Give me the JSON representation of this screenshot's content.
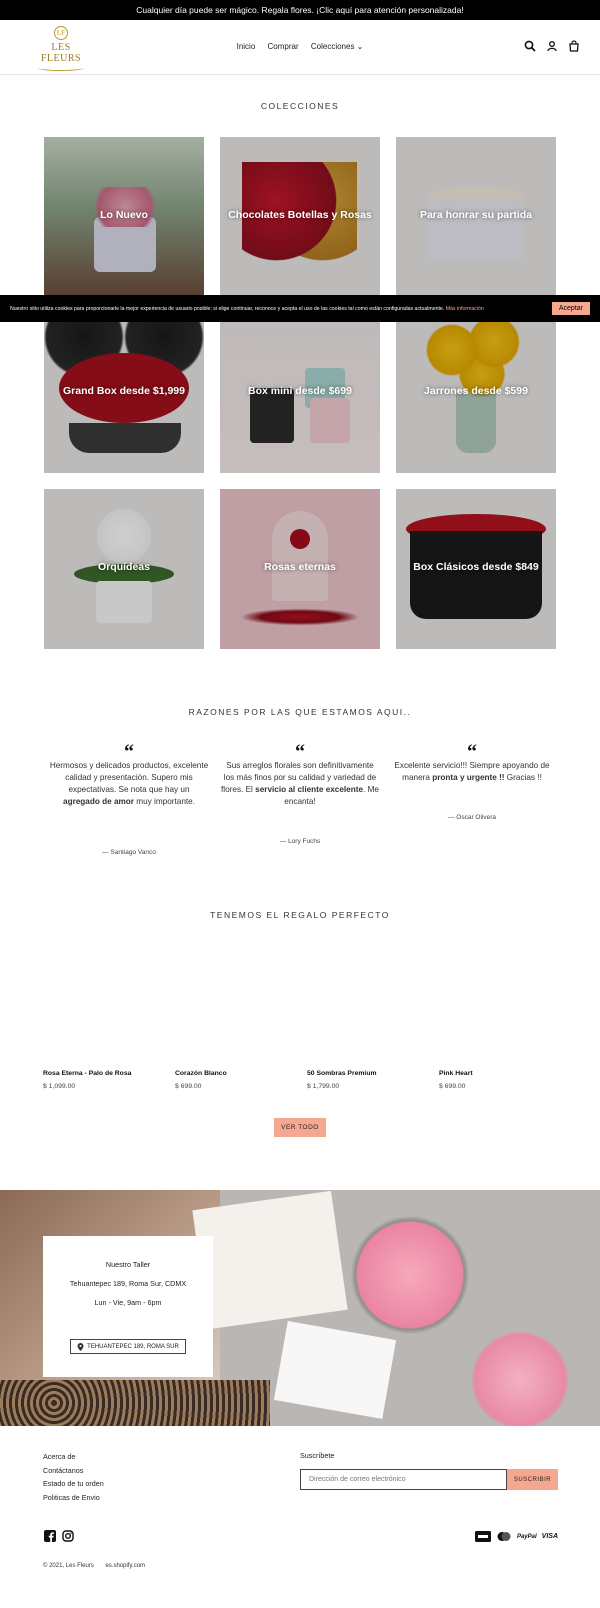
{
  "announcement": "Cualquier día puede ser mágico. Regala flores. ¡Clic aquí para atención personalizada!",
  "logo": {
    "monogram": "LF",
    "wordmark": "LES FLEURS"
  },
  "nav": [
    "Inicio",
    "Comprar",
    "Colecciones ⌄"
  ],
  "header_icons": [
    "search-icon",
    "account-icon",
    "cart-icon"
  ],
  "collections": {
    "title": "COLECCIONES",
    "items": [
      "Lo Nuevo",
      "Chocolates Botellas y Rosas",
      "Para honrar su partida",
      "Grand Box desde $1,999",
      "Box mini desde $699",
      "Jarrones desde $599",
      "Orquídeas",
      "Rosas eternas",
      "Box Clásicos desde $849"
    ]
  },
  "cookie": {
    "text": "Nuestro sitio utiliza cookies para proporcionarle la mejor experiencia de usuario posible; si elige continuar, reconoce y acepta el uso de las cookies tal como están configuradas actualmente.",
    "more": "Más información",
    "accept": "Aceptar"
  },
  "testimonials": {
    "title": "RAZONES POR LAS QUE ESTAMOS AQUI..",
    "quote_mark": "“",
    "items": [
      {
        "pre": "Hermosos y delicados productos, excelente calidad y presentación. Supero mis expectativas. Se nota que hay un ",
        "bold": "agregado de amor",
        "post": " muy importante.",
        "author": "— Santiago Vanco"
      },
      {
        "pre": "Sus arreglos florales son definitivamente los más finos por su calidad y variedad de flores. El ",
        "bold": "servicio al cliente excelente",
        "post": ". Me encanta!",
        "author": "— Lory Fuchs"
      },
      {
        "pre": "Excelente servicio!!! Siempre apoyando de manera ",
        "bold": "pronta y urgente !!",
        "post": " Gracias !!",
        "author": "— Oscar Olivera"
      }
    ]
  },
  "gift": {
    "title": "TENEMOS EL REGALO PERFECTO",
    "products": [
      {
        "name": "Rosa Eterna - Palo de Rosa",
        "price": "$ 1,099.00"
      },
      {
        "name": "Corazón Blanco",
        "price": "$ 699.00"
      },
      {
        "name": "50 Sombras Premium",
        "price": "$ 1,799.00"
      },
      {
        "name": "Pink Heart",
        "price": "$ 699.00"
      }
    ],
    "view_all": "VER TODO"
  },
  "store": {
    "name": "Nuestro Taller",
    "address": "Tehuantepec 189, Roma Sur, CDMX",
    "hours": "Lun - Vie, 9am - 6pm",
    "map_button": "TEHUANTEPEC 189, ROMA SUR"
  },
  "footer": {
    "links": [
      "Acerca de",
      "Contáctanos",
      "Estado de tu orden",
      "Politicas de Envio"
    ],
    "subscribe_label": "Suscríbete",
    "email_placeholder": "Dirección de correo electrónico",
    "subscribe_button": "SUSCRIBIR",
    "payments": [
      "American Express",
      "Mastercard",
      "PayPal",
      "VISA"
    ],
    "copyright": "© 2021, Les Fleurs",
    "powered": "es.shopify.com"
  },
  "colors": {
    "accent": "#f5a88f",
    "dark": "#000000",
    "gold": "#b8962e"
  }
}
